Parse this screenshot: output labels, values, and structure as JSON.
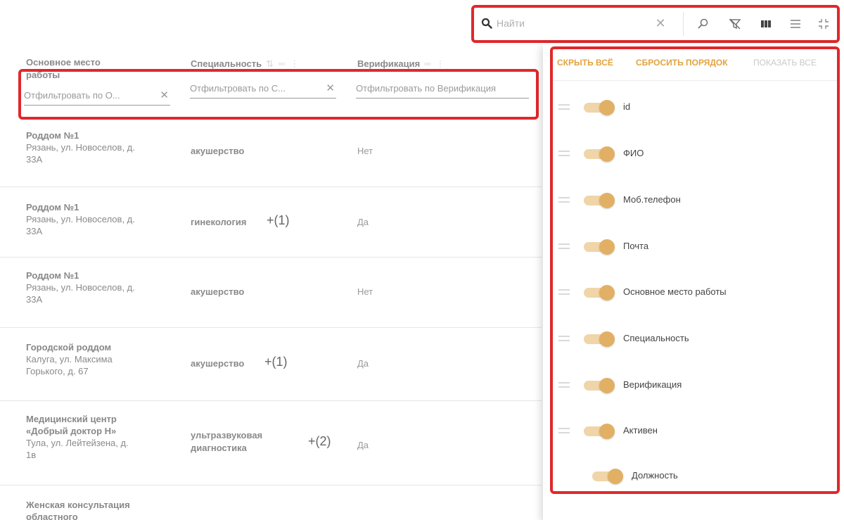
{
  "search": {
    "placeholder": "Найти"
  },
  "columns": {
    "work": {
      "label_line1": "Основное место",
      "label_line2": "работы",
      "filter_placeholder": "Отфильтровать по О..."
    },
    "specialty": {
      "label": "Специальность",
      "filter_placeholder": "Отфильтровать по С..."
    },
    "verification": {
      "label": "Верификация",
      "filter_placeholder": "Отфильтровать по Верификация"
    }
  },
  "rows": [
    {
      "work_name": "Роддом №1",
      "work_addr1": "Рязань, ул. Новоселов, д.",
      "work_addr2": "33А",
      "work_addr3": "",
      "specialty1": "акушерство",
      "specialty2": "",
      "more": "",
      "verification": "Нет"
    },
    {
      "work_name": "Роддом №1",
      "work_addr1": "Рязань, ул. Новоселов, д.",
      "work_addr2": "33А",
      "work_addr3": "",
      "specialty1": "гинекология",
      "specialty2": "",
      "more": "+(1)",
      "verification": "Да"
    },
    {
      "work_name": "Роддом №1",
      "work_addr1": "Рязань, ул. Новоселов, д.",
      "work_addr2": "33А",
      "work_addr3": "",
      "specialty1": "акушерство",
      "specialty2": "",
      "more": "",
      "verification": "Нет"
    },
    {
      "work_name": "Городской роддом",
      "work_addr1": "Калуга, ул. Максима",
      "work_addr2": "Горького, д. 67",
      "work_addr3": "",
      "specialty1": "акушерство",
      "specialty2": "",
      "more": "+(1)",
      "verification": "Да"
    },
    {
      "work_name": "Медицинский центр",
      "work_name2": "«Добрый доктор Н»",
      "work_addr1": "Тула, ул. Лейтейзена, д.",
      "work_addr2": "1в",
      "specialty1": "ультразвуковая",
      "specialty2": "диагностика",
      "more": "+(2)",
      "verification": "Да"
    },
    {
      "work_name": "Женская консультация",
      "work_name2": "областного"
    }
  ],
  "panel": {
    "hide_all": "СКРЫТЬ ВСЁ",
    "reset_order": "СБРОСИТЬ ПОРЯДОК",
    "show_all": "ПОКАЗАТЬ ВСЕ",
    "items": [
      {
        "label": "id",
        "enabled": true
      },
      {
        "label": "ФИО",
        "enabled": true
      },
      {
        "label": "Моб.телефон",
        "enabled": true
      },
      {
        "label": "Почта",
        "enabled": true
      },
      {
        "label": "Основное место работы",
        "enabled": true
      },
      {
        "label": "Специальность",
        "enabled": true
      },
      {
        "label": "Верификация",
        "enabled": true
      },
      {
        "label": "Активен",
        "enabled": true
      },
      {
        "label": "Должность",
        "enabled": true
      }
    ]
  },
  "colors": {
    "accent": "#e2b064",
    "highlight": "#e0282c"
  }
}
